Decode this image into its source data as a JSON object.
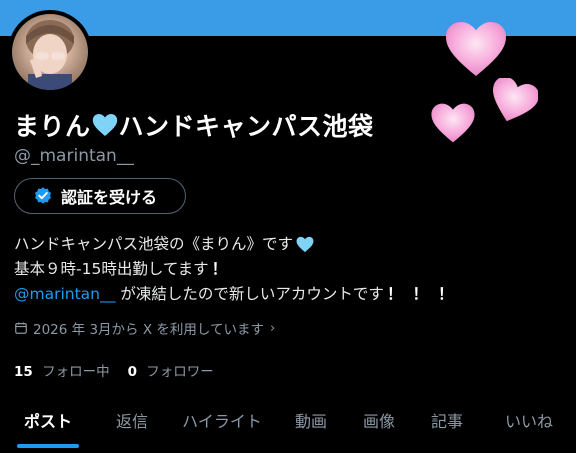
{
  "profile": {
    "display_name_part1": "まりん",
    "display_name_part2": "ハンドキャンパス池袋",
    "name_emoji": "light-blue-heart-emoji",
    "handle": "@_marintan__"
  },
  "verify_button": {
    "label": "認証を受ける",
    "icon": "verified-badge-icon"
  },
  "bio": {
    "line1": "ハンドキャンパス池袋の《まりん》です",
    "line2": "基本９時-15時出勤してます",
    "line3_mention": "@marintan__",
    "line3_text": " が凍結したので新しいアカウントです",
    "excl": "！"
  },
  "joined": {
    "text": "2026 年 3月から X を利用しています",
    "chevron": "›",
    "icon": "calendar-icon"
  },
  "stats": {
    "following_count": "15",
    "following_label": "フォロー中",
    "followers_count": "0",
    "followers_label": "フォロワー"
  },
  "tabs": [
    {
      "label": "ポスト",
      "active": true
    },
    {
      "label": "返信"
    },
    {
      "label": "ハイライト"
    },
    {
      "label": "動画"
    },
    {
      "label": "画像"
    },
    {
      "label": "記事"
    },
    {
      "label": "いいね"
    }
  ],
  "colors": {
    "banner": "#3a9ce6",
    "accent": "#1d9bf0",
    "muted": "#8b98a5",
    "heart_emoji": "#7fd3f7",
    "pink_heart": "#f7a8da"
  }
}
